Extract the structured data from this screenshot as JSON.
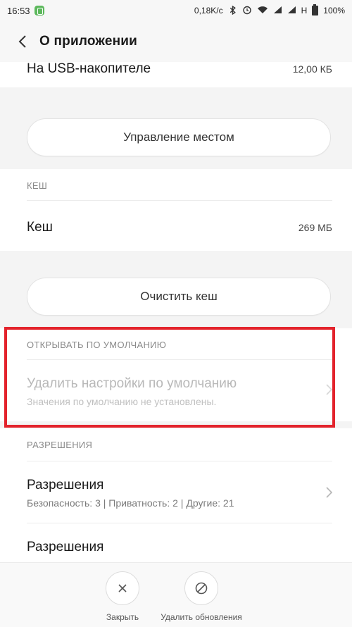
{
  "status_bar": {
    "time": "16:53",
    "network_speed": "0,18K/c",
    "network_type": "H",
    "battery": "100%"
  },
  "app_bar": {
    "title": "О приложении",
    "back_icon": "chevron-left-icon"
  },
  "storage": {
    "usb_label": "На USB-накопителе",
    "usb_value": "12,00 КБ",
    "manage_button": "Управление местом"
  },
  "cache": {
    "section": "КЕШ",
    "label": "Кеш",
    "value": "269 МБ",
    "clear_button": "Очистить кеш"
  },
  "defaults": {
    "section": "ОТКРЫВАТЬ ПО УМОЛЧАНИЮ",
    "title": "Удалить настройки по умолчанию",
    "subtitle": "Значения по умолчанию не установлены."
  },
  "permissions": {
    "section": "РАЗРЕШЕНИЯ",
    "item1_title": "Разрешения",
    "item1_sub": "Безопасность: 3 | Приватность: 2 | Другие: 21",
    "item2_title": "Разрешения"
  },
  "bottom_bar": {
    "close_label": "Закрыть",
    "uninstall_updates_label": "Удалить обновления"
  },
  "colors": {
    "highlight": "#e3232c",
    "background": "#f4f4f4",
    "card": "#ffffff"
  }
}
